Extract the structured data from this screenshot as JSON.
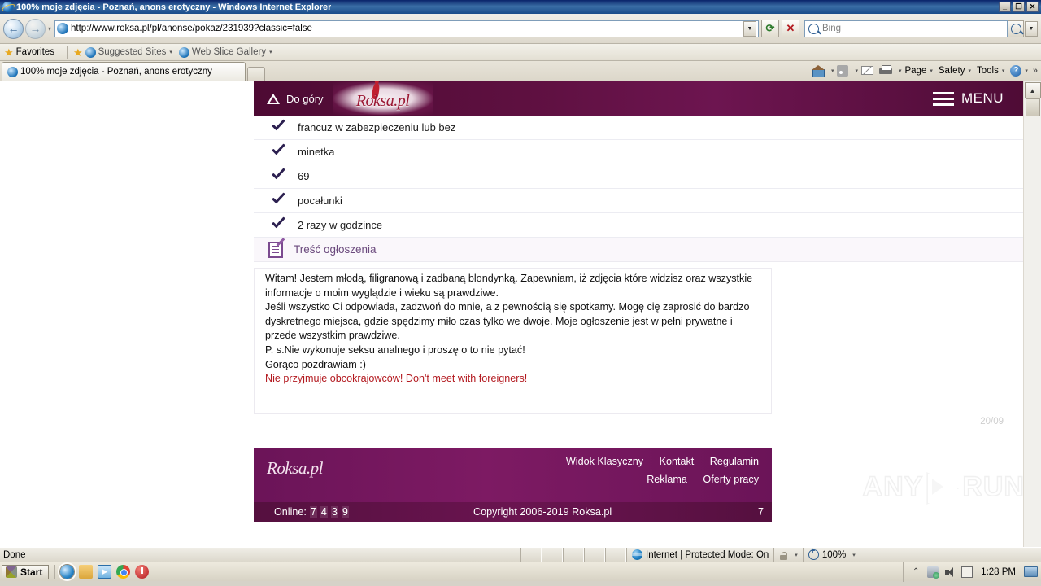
{
  "window": {
    "title": "100% moje zdjęcia - Poznań, anons erotyczny - Windows Internet Explorer",
    "minimize": "_",
    "restore": "❐",
    "close": "✕"
  },
  "nav": {
    "back": "←",
    "forward": "→",
    "url": "http://www.roksa.pl/pl/anonse/pokaz/231939?classic=false",
    "refresh": "⟳",
    "stop": "✕",
    "search_placeholder": "Bing",
    "search_go": "search-icon"
  },
  "favbar": {
    "favorites_label": "Favorites",
    "items": [
      {
        "label": "Suggested Sites",
        "caret": "▾"
      },
      {
        "label": "Web Slice Gallery",
        "caret": "▾"
      }
    ]
  },
  "tabs": {
    "active_tab": "100% moje zdjęcia - Poznań, anons erotyczny",
    "new_tab": ""
  },
  "commandbar": {
    "items": [
      {
        "label": "",
        "icon": "home-icon",
        "caret": "▾"
      },
      {
        "label": "",
        "icon": "rss-icon",
        "caret": "▾"
      },
      {
        "label": "",
        "icon": "mail-icon",
        "caret": ""
      },
      {
        "label": "",
        "icon": "print-icon",
        "caret": "▾"
      },
      {
        "label": "Page",
        "icon": "",
        "caret": "▾"
      },
      {
        "label": "Safety",
        "icon": "",
        "caret": "▾"
      },
      {
        "label": "Tools",
        "icon": "",
        "caret": "▾"
      },
      {
        "label": "",
        "icon": "help-icon",
        "caret": "▾"
      }
    ],
    "overflow": "»"
  },
  "site": {
    "header": {
      "top_link": "Do góry",
      "logo": "Roksa.pl",
      "menu_label": "MENU"
    },
    "checklist": [
      "francuz w zabezpieczeniu lub bez",
      "minetka",
      "69",
      "pocałunki",
      "2 razy w godzince"
    ],
    "section_title": "Treść ogłoszenia",
    "content_paragraphs": [
      "Witam! Jestem młodą, filigranową i zadbaną blondynką. Zapewniam, iż zdjęcia które widzisz oraz wszystkie informacje o moim wyglądzie i wieku  są prawdziwe.",
      "Jeśli wszystko Ci odpowiada, zadzwoń  do mnie, a z pewnością się spotkamy. Mogę cię zaprosić do bardzo dyskretnego miejsca, gdzie spędzimy miło czas tylko we dwoje. Moje ogłoszenie jest w pełni prywatne i przede wszystkim prawdziwe.",
      "P. s.Nie wykonuje seksu analnego i proszę o to nie pytać!",
      "Gorąco pozdrawiam :)"
    ],
    "content_warning": "Nie przyjmuje obcokrajowców! Don't meet with foreigners!",
    "date_stamp": "20/09",
    "footer": {
      "logo": "Roksa.pl",
      "links_row1": [
        "Widok Klasyczny",
        "Kontakt",
        "Regulamin"
      ],
      "links_row2": [
        "Reklama",
        "Oferty pracy"
      ],
      "online_label": "Online:",
      "online_digits": [
        "7",
        "4",
        "3",
        "9"
      ],
      "copyright": "Copyright 2006-2019 Roksa.pl",
      "tail": "7"
    },
    "watermark": {
      "left": "ANY",
      "right": "RUN"
    }
  },
  "statusbar": {
    "status": "Done",
    "zone": "Internet | Protected Mode: On",
    "zoom": "100%",
    "zoom_caret": "▾"
  },
  "taskbar": {
    "start": "Start",
    "quicklaunch": [
      "ie-icon",
      "folder-icon",
      "media-player-icon",
      "chrome-icon",
      "stop-icon"
    ],
    "clock": "1:28 PM"
  },
  "colors": {
    "brand_purple": "#6b1458",
    "header_dark": "#5e1040",
    "accent_red": "#b3191f",
    "check_navy": "#2c2050",
    "section_purple": "#6b4a7d"
  }
}
